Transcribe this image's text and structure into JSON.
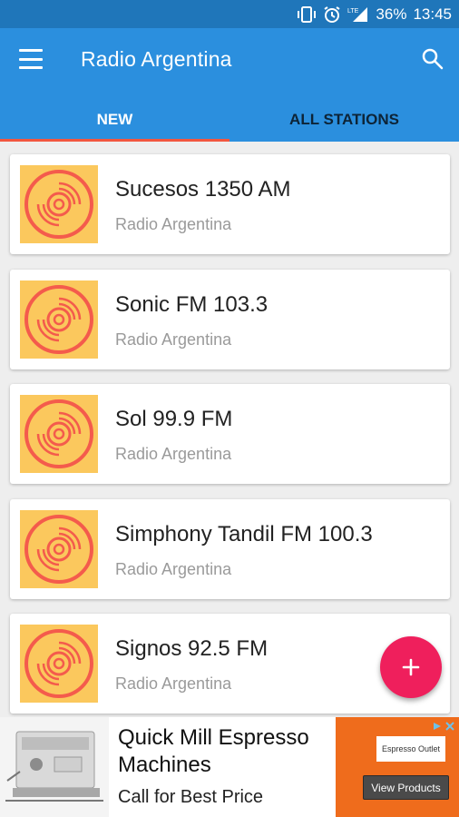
{
  "status_bar": {
    "battery_percent": "36%",
    "time": "13:45",
    "network_label": "LTE"
  },
  "app_bar": {
    "title": "Radio Argentina",
    "menu_icon": "hamburger-menu-icon",
    "search_icon": "search-icon"
  },
  "tabs": [
    {
      "label": "NEW",
      "active": true
    },
    {
      "label": "ALL STATIONS",
      "active": false
    }
  ],
  "stations": [
    {
      "name": "Sucesos 1350 AM",
      "subtitle": "Radio Argentina"
    },
    {
      "name": "Sonic FM 103.3",
      "subtitle": "Radio Argentina"
    },
    {
      "name": "Sol 99.9 FM",
      "subtitle": "Radio Argentina"
    },
    {
      "name": "Simphony Tandil FM 100.3",
      "subtitle": "Radio Argentina"
    },
    {
      "name": "Signos 92.5 FM",
      "subtitle": "Radio Argentina"
    }
  ],
  "fab": {
    "icon": "plus-icon"
  },
  "ad": {
    "headline": "Quick Mill Espresso Machines",
    "subline": "Call for Best Price",
    "logo_text": "Espresso Outlet",
    "cta": "View Products"
  },
  "colors": {
    "status_bar": "#1f76ba",
    "app_bar": "#2b8fde",
    "tab_indicator": "#f2563f",
    "thumb_bg": "#fbc85d",
    "disc": "#f45b4c",
    "fab": "#ef1f5c",
    "ad_accent": "#ef6c1c"
  }
}
